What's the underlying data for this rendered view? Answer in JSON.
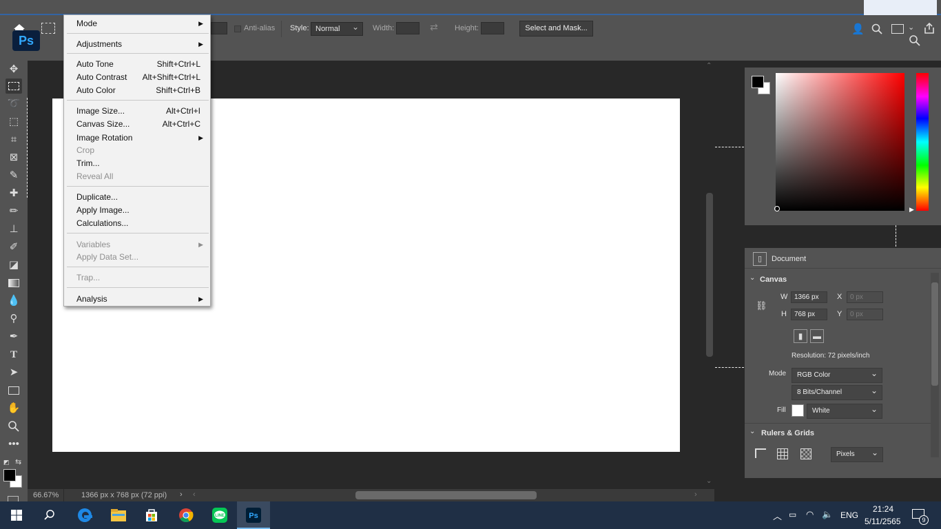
{
  "app": {
    "name": "Ps"
  },
  "options_bar": {
    "anti_alias": "Anti-alias",
    "style_label": "Style:",
    "style_value": "Normal",
    "width_label": "Width:",
    "height_label": "Height:",
    "select_and_mask": "Select and Mask..."
  },
  "image_menu": {
    "items": [
      {
        "label": "Mode",
        "shortcut": "",
        "submenu": true,
        "disabled": false
      },
      {
        "label": "Adjustments",
        "shortcut": "",
        "submenu": true,
        "disabled": false
      },
      {
        "label": "Auto Tone",
        "shortcut": "Shift+Ctrl+L",
        "submenu": false,
        "disabled": false
      },
      {
        "label": "Auto Contrast",
        "shortcut": "Alt+Shift+Ctrl+L",
        "submenu": false,
        "disabled": false
      },
      {
        "label": "Auto Color",
        "shortcut": "Shift+Ctrl+B",
        "submenu": false,
        "disabled": false
      },
      {
        "label": "Image Size...",
        "shortcut": "Alt+Ctrl+I",
        "submenu": false,
        "disabled": false
      },
      {
        "label": "Canvas Size...",
        "shortcut": "Alt+Ctrl+C",
        "submenu": false,
        "disabled": false
      },
      {
        "label": "Image Rotation",
        "shortcut": "",
        "submenu": true,
        "disabled": false
      },
      {
        "label": "Crop",
        "shortcut": "",
        "submenu": false,
        "disabled": true
      },
      {
        "label": "Trim...",
        "shortcut": "",
        "submenu": false,
        "disabled": false
      },
      {
        "label": "Reveal All",
        "shortcut": "",
        "submenu": false,
        "disabled": true
      },
      {
        "label": "Duplicate...",
        "shortcut": "",
        "submenu": false,
        "disabled": false
      },
      {
        "label": "Apply Image...",
        "shortcut": "",
        "submenu": false,
        "disabled": false
      },
      {
        "label": "Calculations...",
        "shortcut": "",
        "submenu": false,
        "disabled": false
      },
      {
        "label": "Variables",
        "shortcut": "",
        "submenu": true,
        "disabled": true
      },
      {
        "label": "Apply Data Set...",
        "shortcut": "",
        "submenu": false,
        "disabled": true
      },
      {
        "label": "Trap...",
        "shortcut": "",
        "submenu": false,
        "disabled": true
      },
      {
        "label": "Analysis",
        "shortcut": "",
        "submenu": true,
        "disabled": false
      }
    ]
  },
  "status": {
    "zoom": "66.67%",
    "doc_info": "1366 px x 768 px (72 ppi)"
  },
  "properties": {
    "title": "Document",
    "canvas_section": "Canvas",
    "w_label": "W",
    "w_value": "1366 px",
    "h_label": "H",
    "h_value": "768 px",
    "x_label": "X",
    "x_placeholder": "0 px",
    "y_label": "Y",
    "y_placeholder": "0 px",
    "resolution": "Resolution: 72 pixels/inch",
    "mode_label": "Mode",
    "mode_value": "RGB Color",
    "bits_value": "8 Bits/Channel",
    "fill_label": "Fill",
    "fill_value": "White",
    "rulers_section": "Rulers & Grids",
    "units_value": "Pixels"
  },
  "colors": {
    "foreground": "#000000",
    "background": "#ffffff",
    "accent": "#31a8ff"
  },
  "taskbar": {
    "lang": "ENG",
    "time": "21:24",
    "date": "5/11/2565",
    "notifications": "9"
  }
}
